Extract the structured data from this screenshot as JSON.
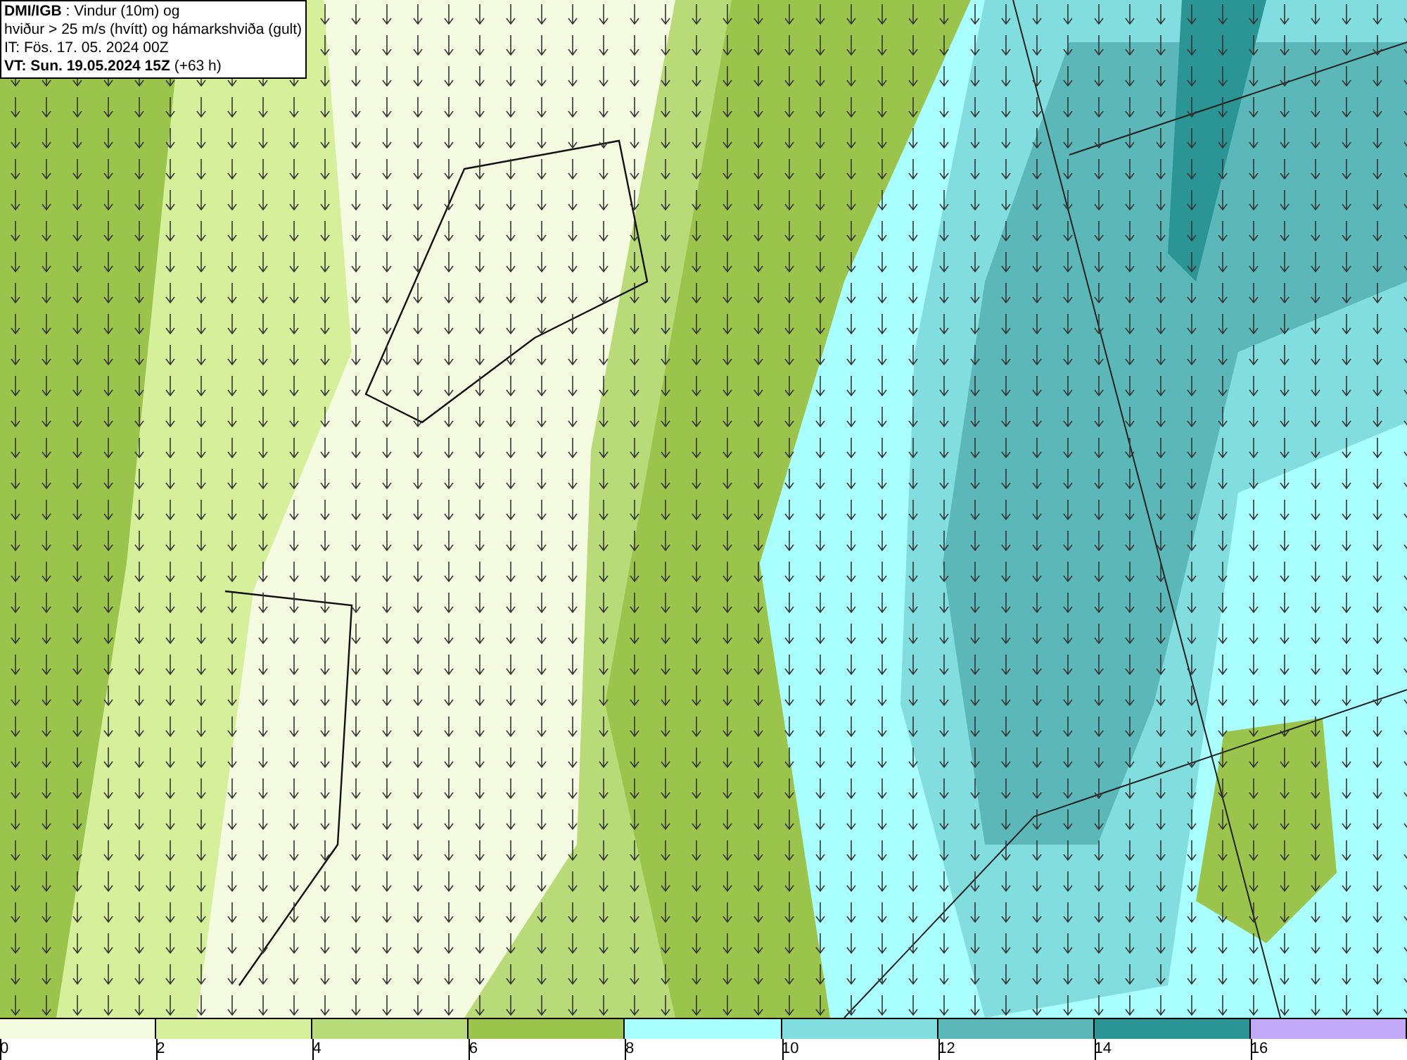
{
  "header": {
    "lines": [
      "**DMI/IGB** : Vindur (10m) og",
      "hviður > 25 m/s (hvítt) og hámarkshviða (gult)",
      "IT: Fös. 17. 05. 2024 00Z",
      "**VT: Sun. 19.05.2024 15Z** (+63 h)"
    ]
  },
  "legend": [
    {
      "label": "0",
      "color": "#f5fbe0"
    },
    {
      "label": "2",
      "color": "#d6ef9a"
    },
    {
      "label": "4",
      "color": "#b8da78"
    },
    {
      "label": "6",
      "color": "#9ac44c"
    },
    {
      "label": "8",
      "color": "#aaffff"
    },
    {
      "label": "10",
      "color": "#82dede"
    },
    {
      "label": "12",
      "color": "#5cb8b8"
    },
    {
      "label": "14",
      "color": "#2b9595"
    },
    {
      "label": "16",
      "color": "#c2aaf8"
    }
  ]
}
